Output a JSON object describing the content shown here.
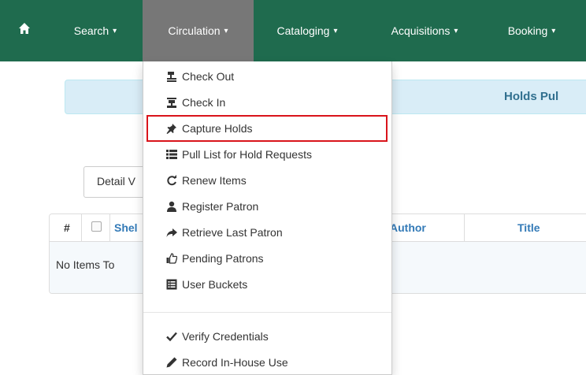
{
  "navbar": {
    "home_icon": "home-icon",
    "items": [
      {
        "label": "Search",
        "caret": "▾"
      },
      {
        "label": "Circulation",
        "caret": "▾"
      },
      {
        "label": "Cataloging",
        "caret": "▾"
      },
      {
        "label": "Acquisitions",
        "caret": "▾"
      },
      {
        "label": "Booking",
        "caret": "▾"
      }
    ],
    "colors": {
      "background": "#1f6b4e",
      "active": "#777777"
    }
  },
  "circulation_menu": {
    "items": [
      {
        "label": "Check Out",
        "icon": "check-out-icon"
      },
      {
        "label": "Check In",
        "icon": "check-in-icon"
      },
      {
        "label": "Capture Holds",
        "icon": "pushpin-icon",
        "highlighted": true
      },
      {
        "label": "Pull List for Hold Requests",
        "icon": "list-icon"
      },
      {
        "label": "Renew Items",
        "icon": "refresh-icon"
      },
      {
        "label": "Register Patron",
        "icon": "user-icon"
      },
      {
        "label": "Retrieve Last Patron",
        "icon": "share-arrow-icon"
      },
      {
        "label": "Pending Patrons",
        "icon": "thumbs-up-icon"
      },
      {
        "label": "User Buckets",
        "icon": "list-alt-icon"
      },
      {
        "label": "Verify Credentials",
        "icon": "checkmark-icon"
      },
      {
        "label": "Record In-House Use",
        "icon": "pencil-icon"
      }
    ],
    "highlight_color": "#d9141b"
  },
  "page": {
    "banner_title": "Holds Pul",
    "detail_view_button": "Detail V",
    "grid": {
      "headers": {
        "number": "#",
        "shelf": "Shel",
        "author": "Author",
        "title": "Title"
      },
      "empty_message": "No Items To"
    }
  }
}
